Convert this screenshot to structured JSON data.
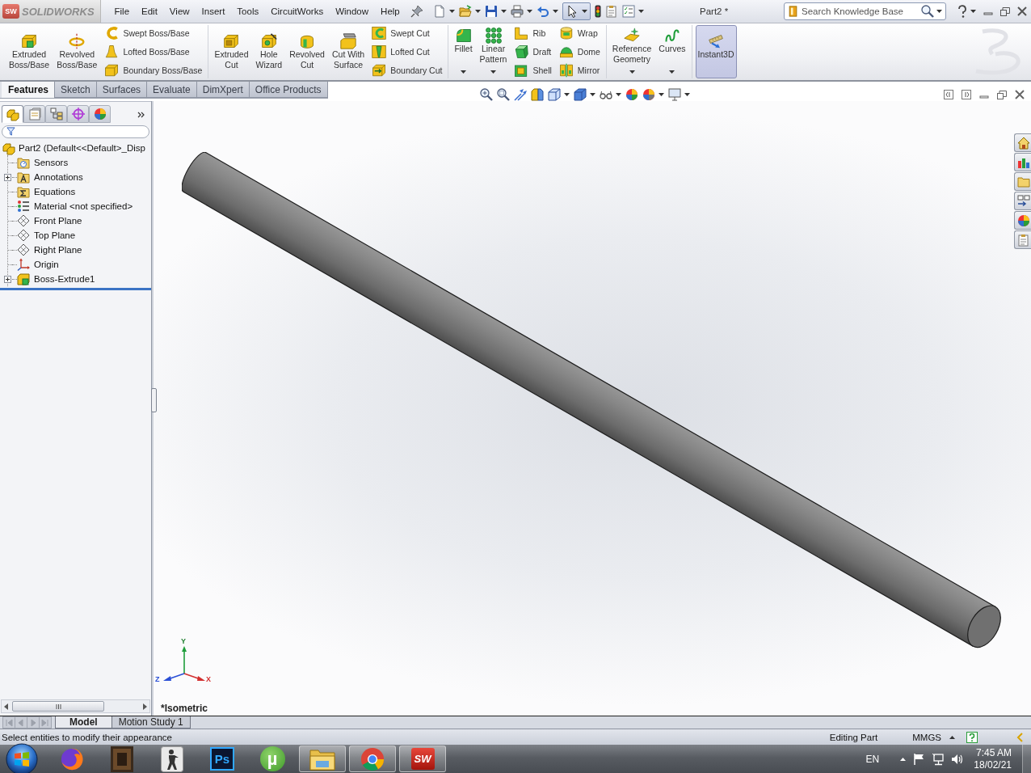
{
  "app": {
    "logo_badge": "SW",
    "logo_text": "SOLIDWORKS"
  },
  "menu_bar": {
    "items": [
      "File",
      "Edit",
      "View",
      "Insert",
      "Tools",
      "CircuitWorks",
      "Window",
      "Help"
    ],
    "select_tool": {
      "pressed": true
    },
    "document_title": "Part2 *",
    "search": {
      "placeholder": "Search Knowledge Base"
    }
  },
  "command_manager": {
    "groups": [
      {
        "large": [
          {
            "label": "Extruded Boss/Base",
            "menu": false,
            "selected": false
          },
          {
            "label": "Revolved Boss/Base",
            "menu": false,
            "selected": false
          }
        ],
        "small_columns": [
          [
            "Swept Boss/Base",
            "Lofted Boss/Base",
            "Boundary Boss/Base"
          ]
        ]
      },
      {
        "large": [
          {
            "label": "Extruded Cut",
            "menu": false,
            "selected": false
          },
          {
            "label": "Hole Wizard",
            "menu": false,
            "selected": false
          },
          {
            "label": "Revolved Cut",
            "menu": false,
            "selected": false
          },
          {
            "label": "Cut With Surface",
            "menu": false,
            "selected": false
          }
        ],
        "small_columns": [
          [
            "Swept Cut",
            "Lofted Cut",
            "Boundary Cut"
          ]
        ]
      },
      {
        "large": [
          {
            "label": "Fillet",
            "menu": true,
            "selected": false
          },
          {
            "label": "Linear Pattern",
            "menu": true,
            "selected": false
          }
        ],
        "small_columns": [
          [
            "Rib",
            "Draft",
            "Shell"
          ],
          [
            "Wrap",
            "Dome",
            "Mirror"
          ]
        ]
      },
      {
        "large": [
          {
            "label": "Reference Geometry",
            "menu": true,
            "selected": false
          },
          {
            "label": "Curves",
            "menu": true,
            "selected": false
          }
        ]
      },
      {
        "large": [
          {
            "label": "Instant3D",
            "menu": false,
            "selected": true
          }
        ]
      }
    ],
    "tabs": [
      {
        "label": "Features",
        "selected": true
      },
      {
        "label": "Sketch",
        "selected": false
      },
      {
        "label": "Surfaces",
        "selected": false
      },
      {
        "label": "Evaluate",
        "selected": false
      },
      {
        "label": "DimXpert",
        "selected": false
      },
      {
        "label": "Office Products",
        "selected": false
      }
    ]
  },
  "feature_manager": {
    "panel_tabs": [
      {
        "selected": true
      },
      {
        "selected": false
      },
      {
        "selected": false
      },
      {
        "selected": false
      },
      {
        "selected": false
      }
    ],
    "tree": {
      "label": "Part2 (Default<<Default>_Disp",
      "children": [
        {
          "label": "Sensors",
          "expandable": false
        },
        {
          "label": "Annotations",
          "expandable": true
        },
        {
          "label": "Equations",
          "expandable": false
        },
        {
          "label": "Material <not specified>",
          "expandable": false
        },
        {
          "label": "Front Plane",
          "expandable": false
        },
        {
          "label": "Top Plane",
          "expandable": false
        },
        {
          "label": "Right Plane",
          "expandable": false
        },
        {
          "label": "Origin",
          "expandable": false
        },
        {
          "label": "Boss-Extrude1",
          "expandable": true
        }
      ]
    }
  },
  "viewport": {
    "triad_labels": [
      "Y",
      "Z",
      "X"
    ],
    "view_name": "*Isometric"
  },
  "bottom_tabs": {
    "nav": [
      {
        "disabled": true
      },
      {
        "disabled": true
      },
      {
        "disabled": true
      },
      {
        "disabled": true
      }
    ],
    "tabs": [
      {
        "label": "Model",
        "selected": true
      },
      {
        "label": "Motion Study 1",
        "selected": false
      }
    ]
  },
  "status_bar": {
    "message": "Select entities to modify their appearance",
    "mode": "Editing Part",
    "units": "MMGS"
  },
  "taskbar": {
    "apps": [
      {
        "running": false
      },
      {
        "running": false
      },
      {
        "running": false
      },
      {
        "label": "Ps",
        "running": false
      },
      {
        "label": "µ",
        "running": false
      },
      {
        "running": true
      },
      {
        "running": true
      },
      {
        "label": "SW",
        "running": true
      }
    ],
    "language": "EN",
    "time": "7:45 AM",
    "date": "18/02/21"
  }
}
